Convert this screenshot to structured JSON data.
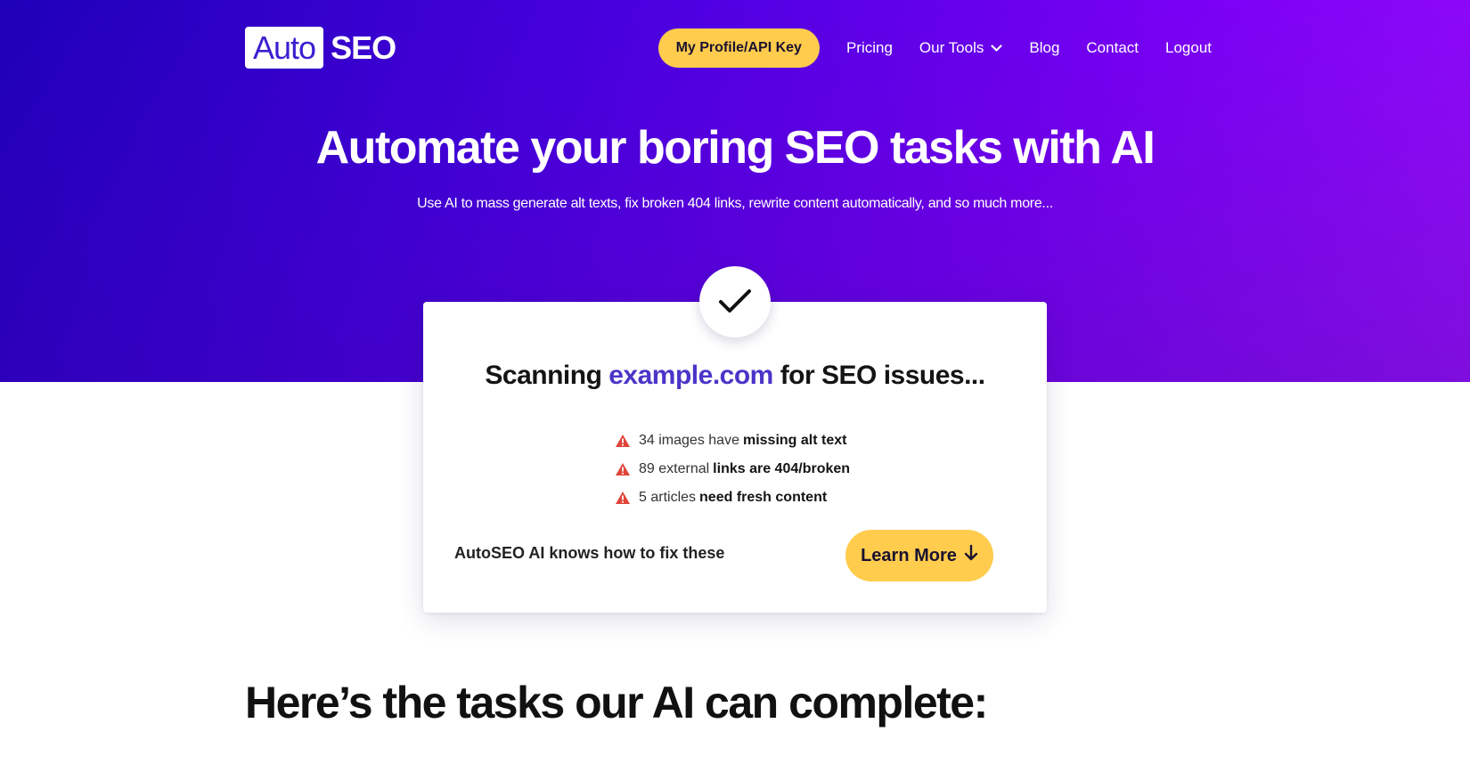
{
  "logo": {
    "box_text": "Auto",
    "text": "SEO"
  },
  "nav": {
    "profile_label": "My Profile/API Key",
    "items": [
      {
        "label": "Pricing"
      },
      {
        "label": "Our Tools"
      },
      {
        "label": "Blog"
      },
      {
        "label": "Contact"
      },
      {
        "label": "Logout"
      }
    ]
  },
  "hero": {
    "title": "Automate your boring SEO tasks with AI",
    "subtitle": "Use AI to mass generate alt texts, fix broken 404 links, rewrite content automatically, and so much more..."
  },
  "scan": {
    "prefix": "Scanning",
    "domain": "example.com",
    "suffix": "for SEO issues...",
    "issues": [
      {
        "text": "34 images have",
        "bold": "missing alt text"
      },
      {
        "text": "89 external",
        "bold": "links are 404/broken"
      },
      {
        "text": "5 articles",
        "bold": "need fresh content"
      }
    ],
    "footer_text": "AutoSEO AI knows how to fix these",
    "button_label": "Learn More"
  },
  "tasks": {
    "heading": "Here’s the tasks our AI can complete:"
  },
  "colors": {
    "accent_yellow": "#ffcc4d",
    "brand_purple": "#4a35c9",
    "warning_red": "#e0453a"
  }
}
